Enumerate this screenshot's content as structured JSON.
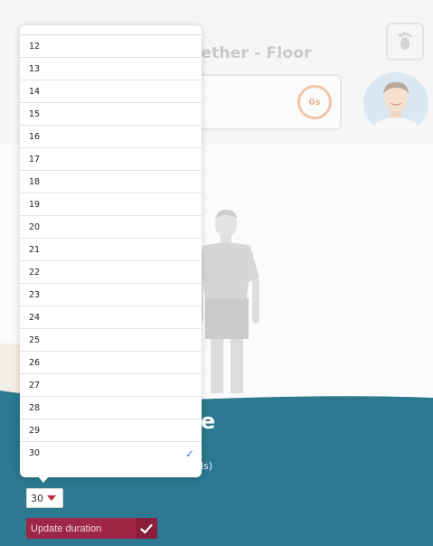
{
  "exercise": {
    "title": "gether - Floor"
  },
  "timer": {
    "value": "0s"
  },
  "section": {
    "heading": "e",
    "duration_label_suffix": "ls)"
  },
  "duration_select": {
    "selected": "30",
    "options": [
      "12",
      "13",
      "14",
      "15",
      "16",
      "17",
      "18",
      "19",
      "20",
      "21",
      "22",
      "23",
      "24",
      "25",
      "26",
      "27",
      "28",
      "29",
      "30"
    ],
    "checkmark": "✓"
  },
  "update_button": {
    "label": "Update duration"
  },
  "colors": {
    "teal": "#2b7890",
    "button": "#9e2747",
    "check_blue": "#3b7ee0"
  },
  "icons": {
    "foot": "foot-icon",
    "check": "check-icon",
    "caret": "caret-down-icon"
  }
}
